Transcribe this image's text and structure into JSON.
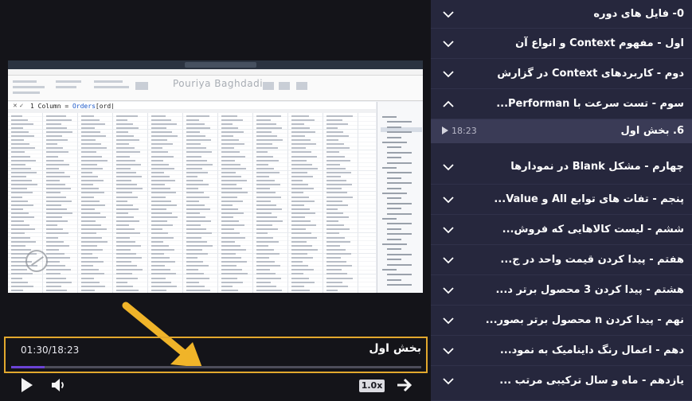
{
  "player": {
    "current_time": "01:30/18:23",
    "chapter_title": "بخش اول",
    "progress_fraction": 0.082,
    "speed_label": "1.0x",
    "accent_color": "#6b43d6",
    "highlight_color": "#e2a82d",
    "video": {
      "watermark": "Pouriya Baghdadi",
      "formula_prefix": "1 Column = ",
      "formula_func": "Orders",
      "formula_suffix": "[ord|"
    }
  },
  "sidebar": {
    "items": [
      {
        "label": "0- فایل های دوره",
        "icon": "chevron-down-icon"
      },
      {
        "label": "اول - مفهوم Context و انواع آن",
        "icon": "chevron-down-icon"
      },
      {
        "label": "دوم - کاربردهای Context در گزارش",
        "icon": "chevron-down-icon"
      },
      {
        "label": "سوم - تست سرعت با Performan...",
        "icon": "chevron-up-icon"
      },
      {
        "label": "چهارم - مشکل Blank در نمودارها",
        "icon": "chevron-down-icon"
      },
      {
        "label": "پنجم - تفات های توابع All و Value...",
        "icon": "chevron-down-icon"
      },
      {
        "label": "ششم - لیست کالاهایی که فروش...",
        "icon": "chevron-down-icon"
      },
      {
        "label": "هفتم - پیدا کردن قیمت واحد در ج...",
        "icon": "chevron-down-icon"
      },
      {
        "label": "هشتم - پیدا کردن 3 محصول برتر د...",
        "icon": "chevron-down-icon"
      },
      {
        "label": "نهم - پیدا کردن n محصول برتر بصور...",
        "icon": "chevron-down-icon"
      },
      {
        "label": "دهم - اعمال رنگ داینامیک به نمود...",
        "icon": "chevron-down-icon"
      },
      {
        "label": "یازدهم - ماه و سال ترکیبی مرتب ...",
        "icon": "chevron-down-icon"
      }
    ],
    "active_sub": {
      "label": "6. بخش اول",
      "duration": "18:23"
    }
  }
}
